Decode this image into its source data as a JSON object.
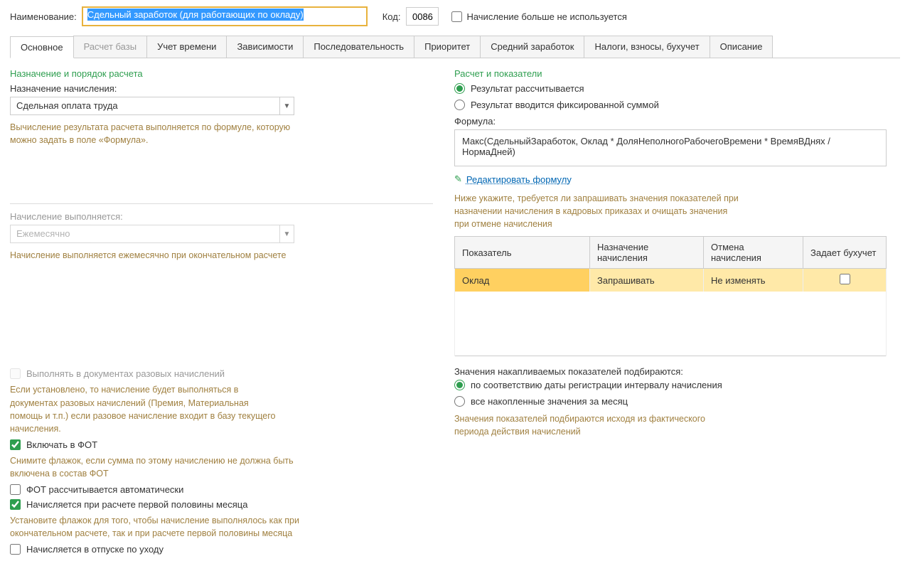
{
  "header": {
    "name_label": "Наименование:",
    "name_value": "Сдельный заработок (для работающих по окладу)",
    "code_label": "Код:",
    "code_value": "0086",
    "not_used_label": "Начисление больше не используется"
  },
  "tabs": [
    "Основное",
    "Расчет базы",
    "Учет времени",
    "Зависимости",
    "Последовательность",
    "Приоритет",
    "Средний заработок",
    "Налоги, взносы, бухучет",
    "Описание"
  ],
  "left": {
    "sec1_title": "Назначение и порядок расчета",
    "assign_label": "Назначение начисления:",
    "assign_value": "Сдельная оплата труда",
    "assign_hint": "Вычисление результата расчета выполняется по формуле, которую можно задать в поле «Формула».",
    "exec_label": "Начисление выполняется:",
    "exec_value": "Ежемесячно",
    "exec_hint": "Начисление выполняется ежемесячно при окончательном расчете",
    "c1_label": "Выполнять в документах разовых начислений",
    "c1_hint": "Если установлено, то начисление будет выполняться в документах разовых начислений (Премия, Материальная помощь и т.п.) если разовое начисление входит в базу текущего начисления.",
    "c2_label": "Включать в ФОТ",
    "c2_hint": "Снимите флажок, если сумма по этому начислению не должна быть включена в состав ФОТ",
    "c3_label": "ФОТ рассчитывается автоматически",
    "c4_label": "Начисляется при расчете первой половины месяца",
    "c4_hint": "Установите флажок для того, чтобы начисление выполнялось как при окончательном расчете, так и при расчете первой половины месяца",
    "c5_label": "Начисляется в отпуске по уходу"
  },
  "right": {
    "sec_title": "Расчет и показатели",
    "r1": "Результат рассчитывается",
    "r2": "Результат вводится фиксированной суммой",
    "formula_label": "Формула:",
    "formula_value": "Макс(СдельныйЗаработок, Оклад * ДоляНеполногоРабочегоВремени * ВремяВДнях / НормаДней)",
    "edit_link": "Редактировать формулу",
    "below_hint": "Ниже укажите, требуется ли запрашивать значения показателей при назначении начисления в кадровых приказах и очищать значения при отмене начисления",
    "th1": "Показатель",
    "th2": "Назначение начисления",
    "th3": "Отмена начисления",
    "th4": "Задает бухучет",
    "row1_c1": "Оклад",
    "row1_c2": "Запрашивать",
    "row1_c3": "Не изменять",
    "accum_label": "Значения накапливаемых показателей подбираются:",
    "a1": "по соответствию даты регистрации интервалу начисления",
    "a2": "все накопленные значения за месяц",
    "accum_hint": "Значения показателей подбираются исходя из фактического периода действия начислений"
  }
}
